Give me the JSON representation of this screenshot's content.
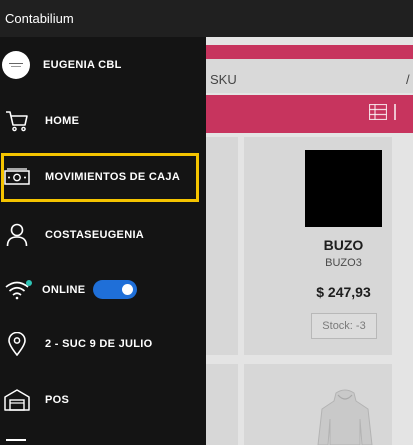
{
  "window": {
    "title": "Contabilium"
  },
  "background": {
    "search_text": "SKU",
    "product": {
      "name": "BUZO",
      "code": "BUZO3",
      "price": "$ 247,93",
      "stock": "Stock: -3"
    }
  },
  "sidebar": {
    "user": "EUGENIA CBL",
    "items": [
      {
        "label": "HOME",
        "icon": "cart-icon"
      },
      {
        "label": "MOVIMIENTOS DE CAJA",
        "icon": "cash-icon"
      },
      {
        "label": "COSTASEUGENIA",
        "icon": "user-icon"
      },
      {
        "label": "ONLINE",
        "icon": "wifi-icon"
      },
      {
        "label": "2 - SUC 9 DE JULIO",
        "icon": "location-pin-icon"
      },
      {
        "label": "POS",
        "icon": "store-icon"
      }
    ],
    "online_enabled": true,
    "highlight_color": "#f5c400",
    "toggle_color": "#1f6fd8"
  },
  "colors": {
    "accent_pink": "#c7345e",
    "sidebar_bg": "#141414"
  }
}
